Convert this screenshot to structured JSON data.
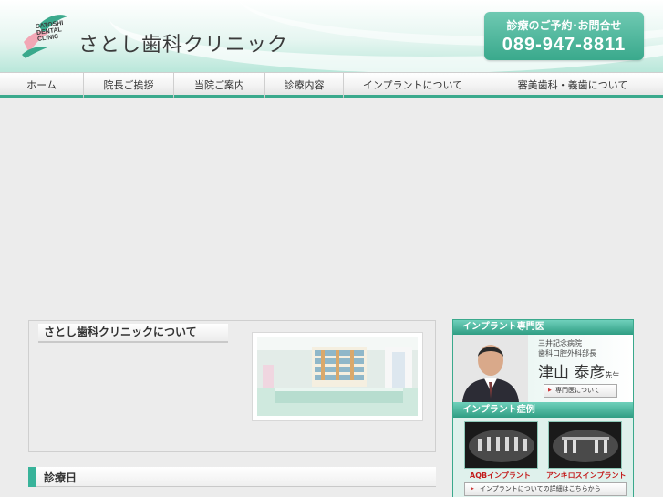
{
  "header": {
    "logo_lines": [
      "SATOSHI",
      "DENTAL",
      "CLINIC"
    ],
    "clinic_name": "さとし歯科クリニック",
    "contact_label": "診療のご予約･お問合せ",
    "phone": "089-947-8811"
  },
  "nav": {
    "items": [
      {
        "label": "ホーム"
      },
      {
        "label": "院長ご挨拶"
      },
      {
        "label": "当院ご案内"
      },
      {
        "label": "診療内容"
      },
      {
        "label": "インプラントについて"
      },
      {
        "label": "審美歯科・義歯について"
      }
    ]
  },
  "about": {
    "title": "さとし歯科クリニックについて"
  },
  "schedule": {
    "title": "診療日"
  },
  "sidebar": {
    "specialist_heading": "インプラント専門医",
    "hospital_line1": "三井記念病院",
    "hospital_line2": "歯科口腔外科部長",
    "doctor_name": "津山 泰彦",
    "doctor_suffix": "先生",
    "doctor_link": "専門医について",
    "cases_heading": "インプラント症例",
    "case1_label": "AQBインプラント",
    "case2_label": "アンキロスインプラント",
    "cases_link": "インプラントについての詳細はこちらから"
  },
  "colors": {
    "accent": "#3aa98c",
    "case_label": "#c31c1c"
  }
}
